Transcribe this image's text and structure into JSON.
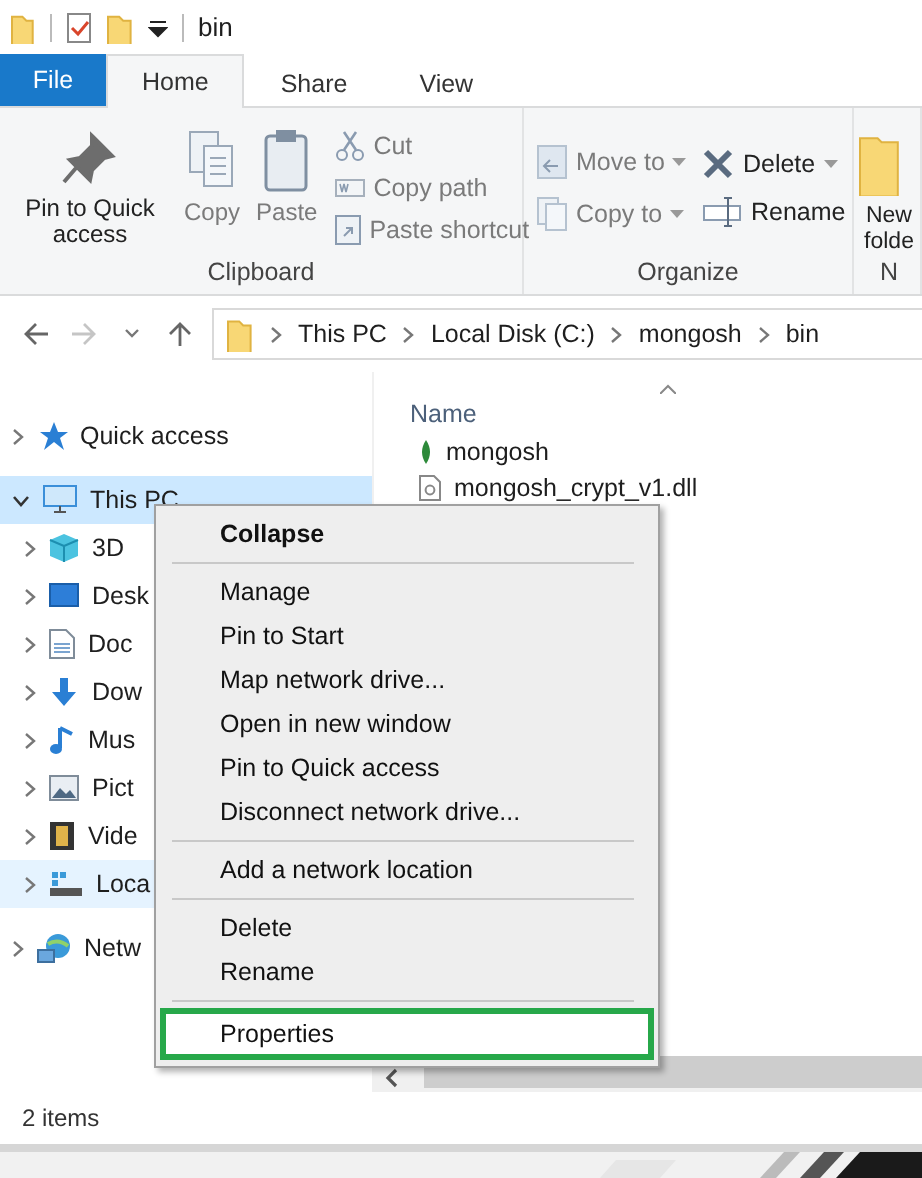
{
  "title_bar": {
    "title": "bin"
  },
  "ribbon_tabs": [
    {
      "label": "File",
      "kind": "file",
      "selected": false
    },
    {
      "label": "Home",
      "kind": "tab",
      "selected": true
    },
    {
      "label": "Share",
      "kind": "tab",
      "selected": false
    },
    {
      "label": "View",
      "kind": "tab",
      "selected": false
    }
  ],
  "ribbon_groups": [
    {
      "label": "Clipboard",
      "commands": [
        {
          "label": "Pin to Quick access",
          "kind": "large",
          "disabled": false
        },
        {
          "label": "Copy",
          "kind": "large",
          "disabled": true
        },
        {
          "label": "Paste",
          "kind": "large",
          "disabled": true
        },
        {
          "label": "Cut",
          "kind": "small",
          "disabled": true
        },
        {
          "label": "Copy path",
          "kind": "small",
          "disabled": true
        },
        {
          "label": "Paste shortcut",
          "kind": "small",
          "disabled": true
        }
      ]
    },
    {
      "label": "Organize",
      "commands": [
        {
          "label": "Move to",
          "kind": "split",
          "disabled": true
        },
        {
          "label": "Copy to",
          "kind": "split",
          "disabled": true
        },
        {
          "label": "Delete",
          "kind": "split",
          "disabled": false
        },
        {
          "label": "Rename",
          "kind": "small",
          "disabled": false
        }
      ]
    },
    {
      "label": "N",
      "commands": [
        {
          "label": "New folde",
          "kind": "large",
          "disabled": false
        }
      ]
    }
  ],
  "address_bar": {
    "path": [
      "This PC",
      "Local Disk (C:)",
      "mongosh",
      "bin"
    ]
  },
  "navigation_pane": {
    "items": [
      {
        "label": "Quick access",
        "expanded": false,
        "selected": false,
        "hovered": false
      },
      {
        "label": "This PC",
        "expanded": true,
        "selected": true,
        "hovered": false,
        "children": [
          {
            "label": "3D",
            "expanded": false,
            "selected": false,
            "hovered": false
          },
          {
            "label": "Desk",
            "expanded": false,
            "selected": false,
            "hovered": false
          },
          {
            "label": "Doc",
            "expanded": false,
            "selected": false,
            "hovered": false
          },
          {
            "label": "Dow",
            "expanded": false,
            "selected": false,
            "hovered": false
          },
          {
            "label": "Mus",
            "expanded": false,
            "selected": false,
            "hovered": false
          },
          {
            "label": "Pict",
            "expanded": false,
            "selected": false,
            "hovered": false
          },
          {
            "label": "Vide",
            "expanded": false,
            "selected": false,
            "hovered": false
          },
          {
            "label": "Loca",
            "expanded": false,
            "selected": false,
            "hovered": true
          }
        ]
      },
      {
        "label": "Netw",
        "expanded": false,
        "selected": false,
        "hovered": false
      }
    ]
  },
  "file_list": {
    "columns": [
      "Name"
    ],
    "rows": [
      {
        "name": "mongosh",
        "kind": "app"
      },
      {
        "name": "mongosh_crypt_v1.dll",
        "kind": "dll"
      }
    ]
  },
  "context_menu": {
    "items": [
      {
        "kind": "item",
        "label": "Collapse",
        "default": true,
        "highlighted": false
      },
      {
        "kind": "separator"
      },
      {
        "kind": "item",
        "label": "Manage",
        "default": false,
        "highlighted": false
      },
      {
        "kind": "item",
        "label": "Pin to Start",
        "default": false,
        "highlighted": false
      },
      {
        "kind": "item",
        "label": "Map network drive...",
        "default": false,
        "highlighted": false
      },
      {
        "kind": "item",
        "label": "Open in new window",
        "default": false,
        "highlighted": false
      },
      {
        "kind": "item",
        "label": "Pin to Quick access",
        "default": false,
        "highlighted": false
      },
      {
        "kind": "item",
        "label": "Disconnect network drive...",
        "default": false,
        "highlighted": false
      },
      {
        "kind": "separator"
      },
      {
        "kind": "item",
        "label": "Add a network location",
        "default": false,
        "highlighted": false
      },
      {
        "kind": "separator"
      },
      {
        "kind": "item",
        "label": "Delete",
        "default": false,
        "highlighted": false
      },
      {
        "kind": "item",
        "label": "Rename",
        "default": false,
        "highlighted": false
      },
      {
        "kind": "separator"
      },
      {
        "kind": "item",
        "label": "Properties",
        "default": false,
        "highlighted": true
      }
    ]
  },
  "status_bar": {
    "text": "2 items"
  }
}
